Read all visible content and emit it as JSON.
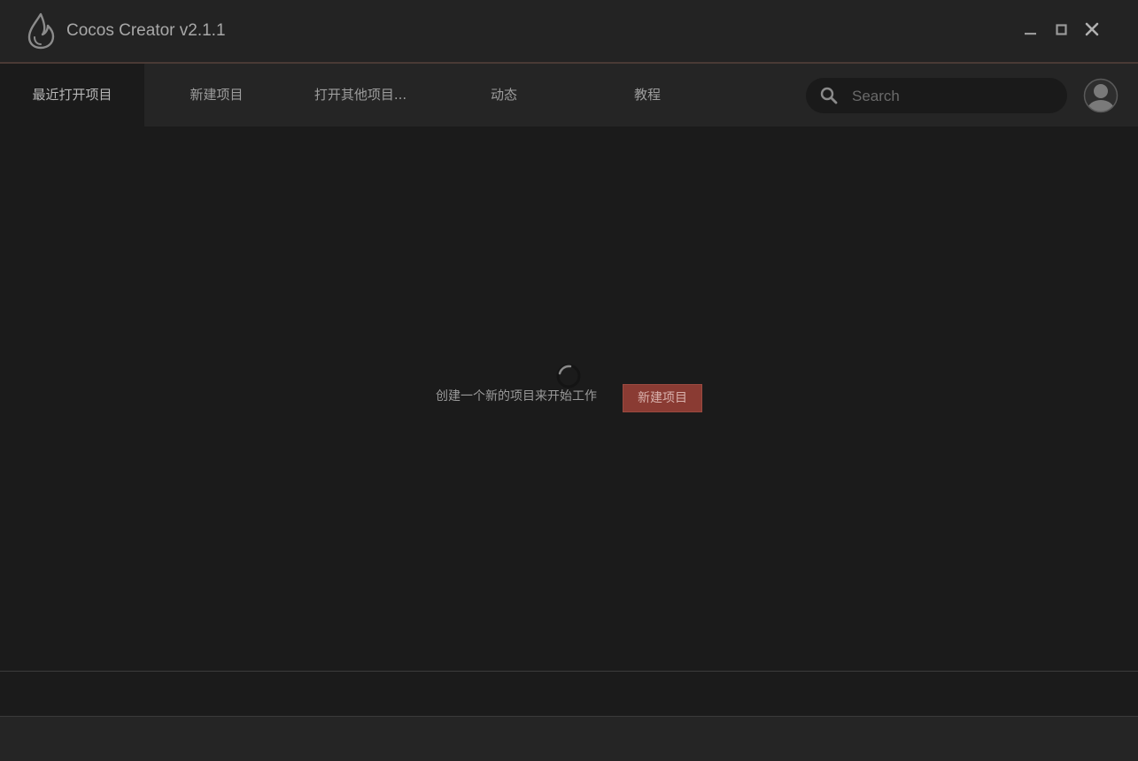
{
  "window": {
    "title": "Cocos Creator v2.1.1",
    "logo_icon": "cocos-drop-logo-icon",
    "controls": {
      "minimize_icon": "minimize-icon",
      "maximize_icon": "maximize-icon",
      "close_icon": "close-icon"
    }
  },
  "nav": {
    "tabs": [
      {
        "label": "最近打开项目",
        "active": true
      },
      {
        "label": "新建项目",
        "active": false
      },
      {
        "label": "打开其他项目...",
        "active": false
      },
      {
        "label": "动态",
        "active": false
      },
      {
        "label": "教程",
        "active": false
      }
    ],
    "search": {
      "placeholder": "Search",
      "value": "",
      "icon": "search-icon"
    },
    "avatar_icon": "user-avatar-icon"
  },
  "main": {
    "loading_icon": "loading-spinner-icon",
    "empty_message": "创建一个新的项目来开始工作",
    "new_project_button": "新建项目"
  },
  "colors": {
    "background": "#1b1b1b",
    "panel": "#252525",
    "accent": "#8a3b33",
    "title_border": "#4a3a35",
    "text": "#9d9d9d"
  }
}
